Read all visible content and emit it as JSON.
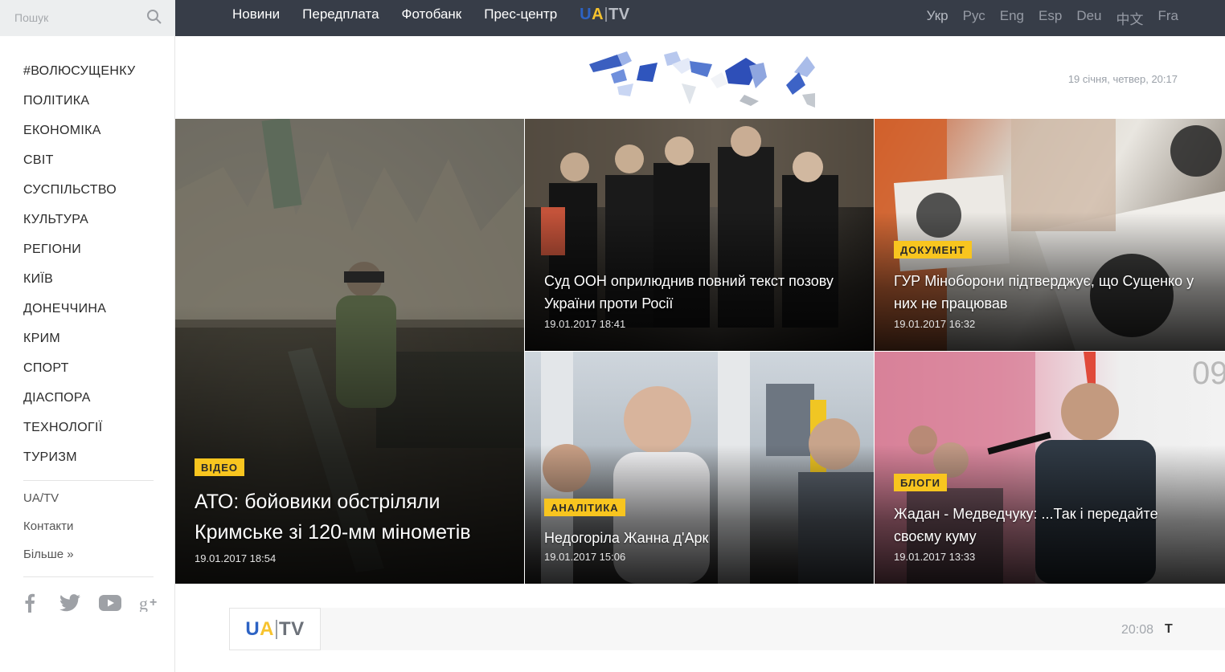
{
  "search": {
    "placeholder": "Пошук"
  },
  "sidebar": {
    "items": [
      {
        "label": "#ВОЛЮСУЩЕНКУ"
      },
      {
        "label": "ПОЛІТИКА"
      },
      {
        "label": "ЕКОНОМІКА"
      },
      {
        "label": "СВІТ"
      },
      {
        "label": "СУСПІЛЬСТВО"
      },
      {
        "label": "КУЛЬТУРА"
      },
      {
        "label": "РЕГІОНИ"
      },
      {
        "label": "КИЇВ"
      },
      {
        "label": "ДОНЕЧЧИНА"
      },
      {
        "label": "КРИМ"
      },
      {
        "label": "СПОРТ"
      },
      {
        "label": "ДІАСПОРА"
      },
      {
        "label": "ТЕХНОЛОГІЇ"
      },
      {
        "label": "ТУРИЗМ"
      }
    ],
    "sub": [
      {
        "label": "UA/TV"
      },
      {
        "label": "Контакти"
      },
      {
        "label": "Більше »"
      }
    ],
    "social": [
      "facebook-icon",
      "twitter-icon",
      "youtube-icon",
      "google-plus-icon"
    ]
  },
  "topnav": {
    "links": [
      {
        "label": "Новини"
      },
      {
        "label": "Передплата"
      },
      {
        "label": "Фотобанк"
      },
      {
        "label": "Прес-центр"
      }
    ],
    "logo": {
      "ua_u": "U",
      "ua_a": "A",
      "tv": "TV"
    },
    "langs": [
      "Укр",
      "Рус",
      "Eng",
      "Esp",
      "Deu",
      "中文",
      "Fra"
    ]
  },
  "header": {
    "date": "19 січня, четвер, 20:17"
  },
  "colors": {
    "accent": "#f8c51f",
    "topbar": "#373d48",
    "brand_blue": "#2d63c4"
  },
  "news": [
    {
      "tag": "ВІДЕО",
      "title": "АТО: бойовики обстріляли Кримське зі 120-мм мінометів",
      "time": "19.01.2017 18:54"
    },
    {
      "tag": "",
      "title": "Суд ООН оприлюднив повний текст позову України проти Росії",
      "time": "19.01.2017 18:41"
    },
    {
      "tag": "ДОКУМЕНТ",
      "title": "ГУР Міноборони підтверджує, що Сущенко у них не працював",
      "time": "19.01.2017 16:32"
    },
    {
      "tag": "АНАЛІТИКА",
      "title": "Недогоріла Жанна д'Арк",
      "time": "19.01.2017 15:06"
    },
    {
      "tag": "БЛОГИ",
      "title": "Жадан - Медведчуку: ...Так і передайте своєму куму",
      "time": "19.01.2017 13:33"
    }
  ],
  "uatv_strip": {
    "logo_ua_u": "U",
    "logo_ua_a": "A",
    "logo_tv": "TV",
    "time": "20:08",
    "text": "Т"
  }
}
